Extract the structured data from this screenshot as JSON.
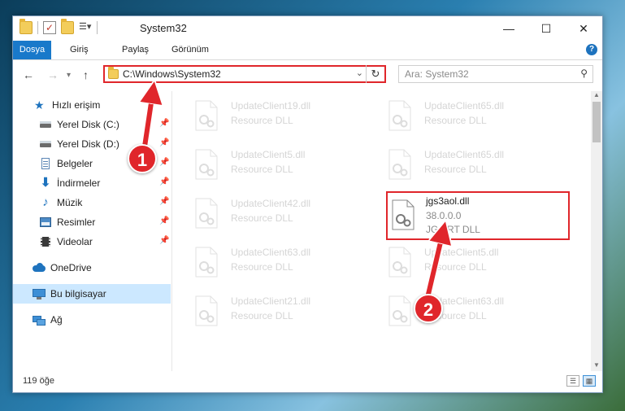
{
  "window": {
    "title": "System32",
    "controls": {
      "minimize": "—",
      "maximize": "☐",
      "close": "✕"
    }
  },
  "ribbon": {
    "tabs": [
      "Dosya",
      "Giriş",
      "Paylaş",
      "Görünüm"
    ]
  },
  "address_bar": {
    "path": "C:\\Windows\\System32",
    "search_placeholder": "Ara: System32"
  },
  "nav_pane": {
    "quick_access": "Hızlı erişim",
    "items": [
      {
        "label": "Yerel Disk (C:)",
        "icon": "drive-icon",
        "pinned": true
      },
      {
        "label": "Yerel Disk (D:)",
        "icon": "drive-icon",
        "pinned": true
      },
      {
        "label": "Belgeler",
        "icon": "documents-icon",
        "pinned": true
      },
      {
        "label": "İndirmeler",
        "icon": "download-icon",
        "pinned": true
      },
      {
        "label": "Müzik",
        "icon": "music-icon",
        "pinned": true
      },
      {
        "label": "Resimler",
        "icon": "pictures-icon",
        "pinned": true
      },
      {
        "label": "Videolar",
        "icon": "videos-icon",
        "pinned": true
      }
    ],
    "onedrive": "OneDrive",
    "this_pc": "Bu bilgisayar",
    "network": "Ağ"
  },
  "files": {
    "left_column": [
      {
        "name": "UpdateClient19.dll",
        "type": "Resource DLL"
      },
      {
        "name": "UpdateClient5.dll",
        "type": "Resource DLL"
      },
      {
        "name": "UpdateClient42.dll",
        "type": "Resource DLL"
      },
      {
        "name": "UpdateClient63.dll",
        "type": "Resource DLL"
      },
      {
        "name": "UpdateClient21.dll",
        "type": "Resource DLL"
      }
    ],
    "right_column": [
      {
        "name": "UpdateClient65.dll",
        "type": "Resource DLL"
      },
      {
        "name": "UpdateClient65.dll",
        "type": "Resource DLL"
      },
      {
        "name": "UpdateClient5.dll",
        "type": "Resource DLL"
      },
      {
        "name": "UpdateClient63.dll",
        "type": "Resource DLL"
      }
    ],
    "highlighted": {
      "name": "jgs3aol.dll",
      "version": "38.0.0.0",
      "description": "JG ART DLL"
    }
  },
  "status_bar": {
    "item_count": "119 öğe"
  },
  "callouts": {
    "one": "1",
    "two": "2"
  },
  "colors": {
    "accent": "#1979ca",
    "highlight": "#e0262b",
    "selection": "#cce8ff"
  }
}
